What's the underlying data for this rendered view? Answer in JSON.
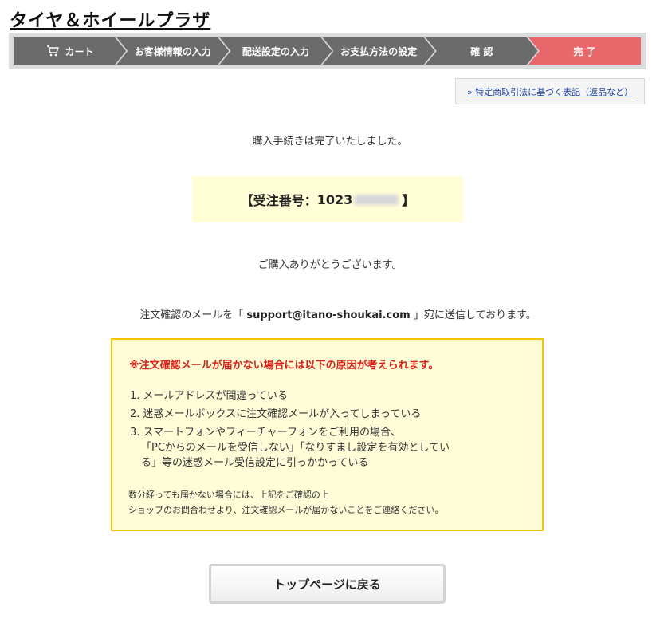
{
  "site": {
    "title": "タイヤ＆ホイールプラザ"
  },
  "steps": [
    {
      "label": "カート",
      "icon": "cart-icon",
      "active": false
    },
    {
      "label": "お客様情報の入力",
      "active": false
    },
    {
      "label": "配送設定の入力",
      "active": false
    },
    {
      "label": "お支払方法の設定",
      "active": false
    },
    {
      "label": "確 認",
      "active": false
    },
    {
      "label": "完 了",
      "active": true
    }
  ],
  "legal_link": {
    "label": "» 特定商取引法に基づく表記（返品など）"
  },
  "messages": {
    "complete": "購入手続きは完了いたしました。",
    "order_prefix": "【受注番号：",
    "order_number_visible": "1023",
    "order_suffix": "】",
    "thanks": "ご購入ありがとうございます。",
    "mail_before": "注文確認のメールを「 ",
    "mail_address": "support@itano-shoukai.com",
    "mail_after": " 」宛に送信しております。"
  },
  "warning": {
    "title": "※注文確認メールが届かない場合には以下の原因が考えられます。",
    "items": [
      "1. メールアドレスが間違っている",
      "2. 迷惑メールボックスに注文確認メールが入ってしまっている",
      "3. スマートフォンやフィーチャーフォンをご利用の場合、",
      "「PCからのメールを受信しない」「なりすまし設定を有効としてい",
      "る」等の迷惑メール受信設定に引っかかっている"
    ],
    "note_line1": "数分経っても届かない場合には、上記をご確認の上",
    "note_line2": "ショップのお問合わせより、注文確認メールが届かないことをご連絡ください。"
  },
  "button": {
    "label": "トップページに戻る"
  },
  "colors": {
    "step_bg": "#6b6b6b",
    "step_active": "#e8676a",
    "warning_border": "#f2c400",
    "warning_title": "#d81f18",
    "highlight_bg": "#fffed6"
  }
}
